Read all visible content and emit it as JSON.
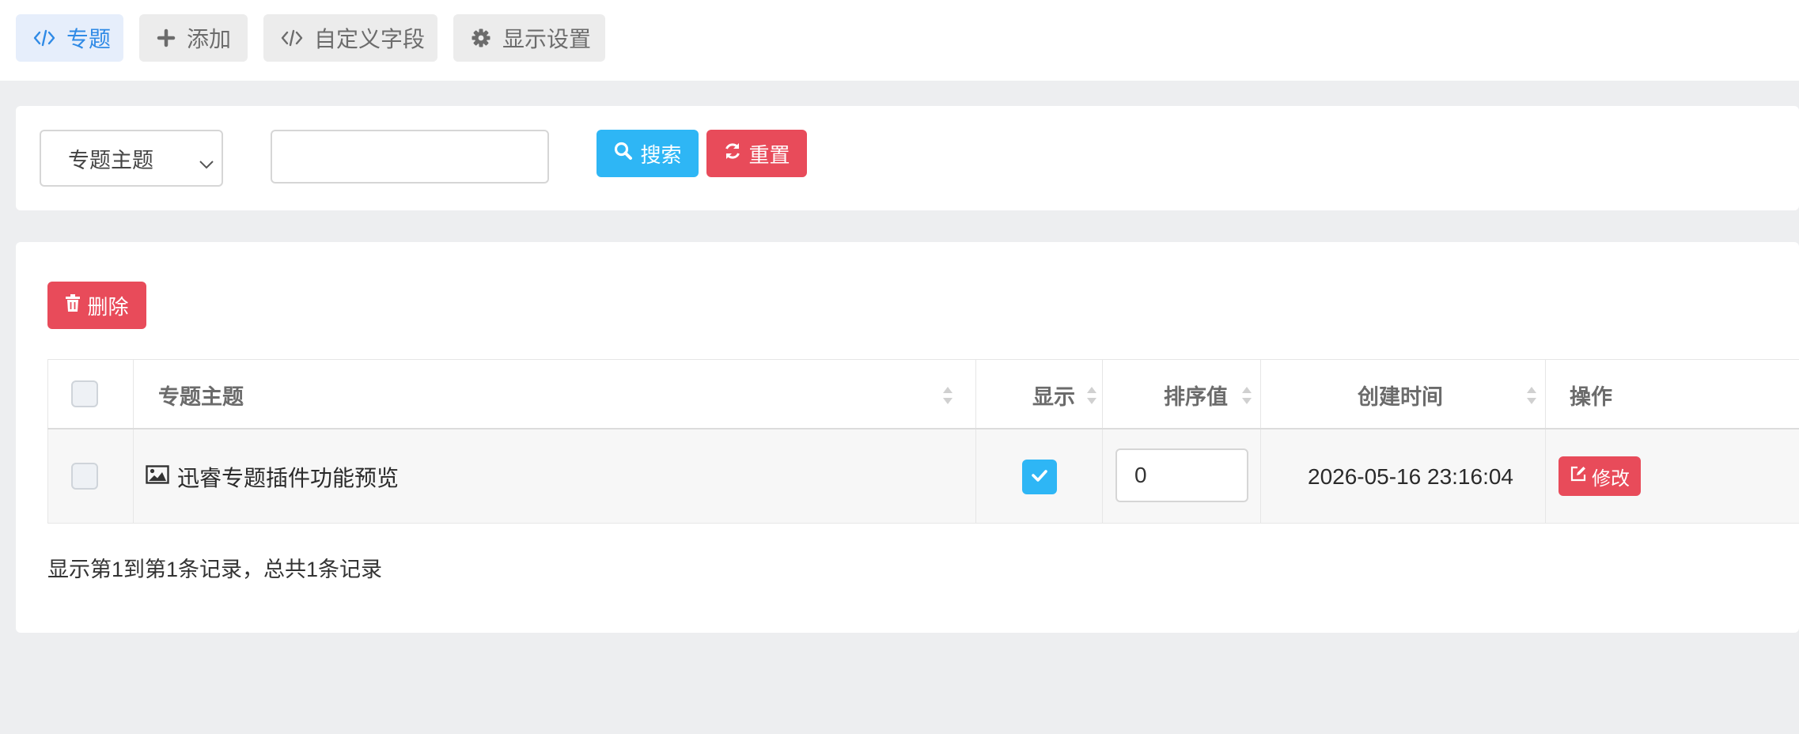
{
  "tabs": [
    {
      "label": "专题",
      "icon": "code-icon",
      "active": true
    },
    {
      "label": "添加",
      "icon": "plus-icon",
      "active": false
    },
    {
      "label": "自定义字段",
      "icon": "code-icon",
      "active": false
    },
    {
      "label": "显示设置",
      "icon": "gear-icon",
      "active": false
    }
  ],
  "search": {
    "field_select_value": "专题主题",
    "keyword_value": "",
    "search_label": "搜索",
    "reset_label": "重置"
  },
  "toolbar": {
    "delete_label": "删除"
  },
  "table": {
    "columns": [
      "专题主题",
      "显示",
      "排序值",
      "创建时间",
      "操作"
    ],
    "rows": [
      {
        "title": "迅睿专题插件功能预览",
        "show": true,
        "sort_value": "0",
        "created": "2026-05-16 23:16:04",
        "action_label": "修改"
      }
    ]
  },
  "pager_info": "显示第1到第1条记录，总共1条记录",
  "colors": {
    "primary": "#2eb6f5",
    "danger": "#e84b5a",
    "active_tab_text": "#2f8ae6",
    "background": "#edeef0"
  }
}
